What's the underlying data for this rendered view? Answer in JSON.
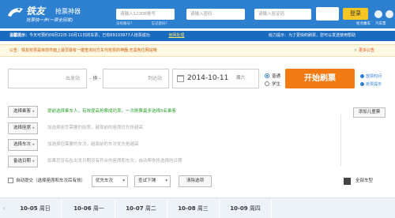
{
  "header": {
    "logo_title": "铁友",
    "logo_sub": "抢票神器",
    "logo_slogan": "抢票快一步(一票全回家)",
    "account_placeholder": "请输入12306账号",
    "password_placeholder": "请输入密码",
    "captcha_placeholder": "请输入验证码",
    "login_label": "登录",
    "links": [
      "没有账号？",
      "忘记密码？"
    ],
    "right_links": [
      "抢点乘车",
      "汽车票"
    ]
  },
  "notice": {
    "label": "温馨提示：",
    "text": "今天可预约09月22日-10月11日的车票，已有69103977人抢票成功",
    "link": "官网处理",
    "right_text": "给力提示：为了更快的刷票，您可以发送",
    "right_link": "使用帮助"
  },
  "announce": {
    "text": "公告：铁友抢票是目前市面上最早最有一键查询对方车代抢票的神器,无需各位网站哦",
    "close": "×",
    "more": "更多公告"
  },
  "query": {
    "from_label": "出发站",
    "swap_label": "- 换 -",
    "to_label": "到达站",
    "date": "2014-10-11",
    "weekday": "周六",
    "radio_normal": "普通",
    "radio_student": "学生",
    "brush_label": "开始刷票",
    "side_links": [
      "放票时间",
      "抢票提示"
    ]
  },
  "options": [
    {
      "label": "选择乘客",
      "tip": "提前选择乘车人，有效提高抢票成功率。一次刷票最多选择5名乘客"
    },
    {
      "label": "选择座席",
      "tip": "加选择座您需要的座席，越靠前的座席优先抢越高"
    },
    {
      "label": "选择车次",
      "tip": "加选择您需要的车次，越靠前的车次优先抢越高"
    },
    {
      "label": "备选日期",
      "tip": "如果您没有在出发日期没有符合的座席和车次，自动帮你抢选择的日期"
    }
  ],
  "child_btn": "添加儿童票",
  "controls": {
    "auto_submit": "自动提交（选择座席和车次后有效）",
    "priority": "优先车次",
    "sort": "查试下铺",
    "clear": "清除选项",
    "right": "全部车型"
  },
  "dates": [
    {
      "date": "10-05",
      "weekday": "周日"
    },
    {
      "date": "10-06",
      "weekday": "周一"
    },
    {
      "date": "10-07",
      "weekday": "周二"
    },
    {
      "date": "10-08",
      "weekday": "周三"
    },
    {
      "date": "10-09",
      "weekday": "周四"
    }
  ],
  "colors": {
    "brand": "#2d7fd0",
    "accent": "#f27a12",
    "login": "#f5c623"
  }
}
